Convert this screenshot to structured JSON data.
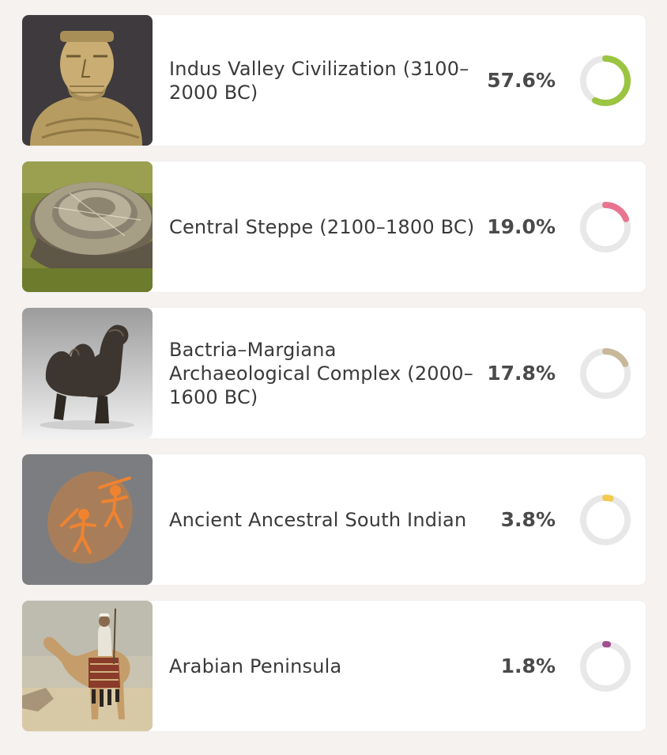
{
  "populations": [
    {
      "name": "Indus Valley Civilization (3100–2000 BC)",
      "name_lines": [
        "Indus Valley Civilization (3100–",
        "2000 BC)"
      ],
      "percent_label": "57.6%",
      "fraction": 0.576,
      "ring_color": "#9bc441",
      "image": "stone-bust-statue"
    },
    {
      "name": "Central Steppe (2100–1800 BC)",
      "name_lines": [
        "Central Steppe (2100–1800 BC)"
      ],
      "percent_label": "19.0%",
      "fraction": 0.19,
      "ring_color": "#e7758f",
      "image": "circular-fortified-settlement"
    },
    {
      "name": "Bactria–Margiana Archaeological Complex (2000–1600 BC)",
      "name_lines": [
        "Bactria–Margiana",
        "Archaeological Complex (2000–",
        "1600 BC)"
      ],
      "percent_label": "17.8%",
      "fraction": 0.178,
      "ring_color": "#c8b89a",
      "image": "bronze-camel-figurine"
    },
    {
      "name": "Ancient Ancestral South Indian",
      "name_lines": [
        "Ancient Ancestral South Indian"
      ],
      "percent_label": "3.8%",
      "fraction": 0.038,
      "ring_color": "#f2ca4e",
      "image": "rock-art-figures"
    },
    {
      "name": "Arabian Peninsula",
      "name_lines": [
        "Arabian Peninsula"
      ],
      "percent_label": "1.8%",
      "fraction": 0.018,
      "ring_color": "#a24f92",
      "image": "camel-rider-painting"
    }
  ],
  "ring_track_color": "#e8e8e8"
}
